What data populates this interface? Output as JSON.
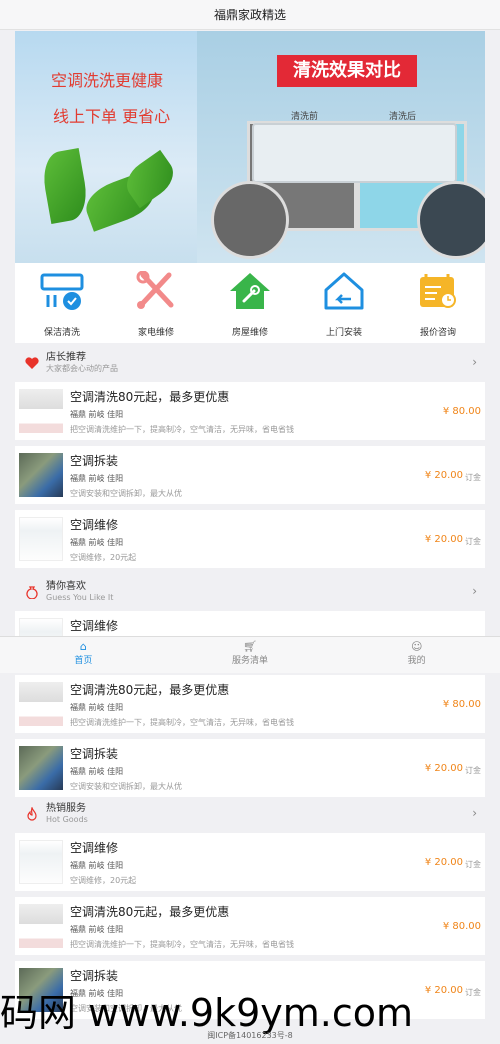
{
  "header": {
    "title": "福鼎家政精选"
  },
  "banner": {
    "line1": "空调洗洗更健康",
    "line2": "线上下单 更省心",
    "tag": "清洗效果对比",
    "before": "清洗前",
    "after": "清洗后"
  },
  "categories": [
    {
      "label": "保洁清洗",
      "icon": "ac-cleaning-icon"
    },
    {
      "label": "家电维修",
      "icon": "tools-icon"
    },
    {
      "label": "房屋维修",
      "icon": "house-wrench-icon"
    },
    {
      "label": "上门安装",
      "icon": "home-return-icon"
    },
    {
      "label": "报价咨询",
      "icon": "calendar-clock-icon"
    }
  ],
  "sections": {
    "recommend": {
      "title": "店长推荐",
      "subtitle": "大家都会心动的产品"
    },
    "guess": {
      "title": "猜你喜欢",
      "subtitle": "Guess You Like It"
    },
    "hot": {
      "title": "热销服务",
      "subtitle": "Hot Goods"
    }
  },
  "products": {
    "wash": {
      "title": "空调清洗80元起，最多更优惠",
      "meta": "福鼎 前岐 佳阳",
      "desc": "把空调清洗维护一下，提高制冷，空气清洁，无异味，省电省钱",
      "price": "¥ 80.00",
      "unit": ""
    },
    "install": {
      "title": "空调拆装",
      "meta": "福鼎 前岐 佳阳",
      "desc": "空调安装和空调拆卸，最大从优",
      "price": "¥ 20.00",
      "unit": "订金"
    },
    "repair": {
      "title": "空调维修",
      "meta": "福鼎 前岐 佳阳",
      "desc": "空调维修，20元起",
      "price": "¥ 20.00",
      "unit": "订金"
    }
  },
  "tabbar": {
    "home": "首页",
    "service": "服务清单",
    "mine": "我的"
  },
  "footer": {
    "icp": "闽ICP备14016233号-8"
  },
  "watermark": "码网 www.9k9ym.com",
  "colors": {
    "accent": "#1e8fe0",
    "price": "#f08519",
    "heart": "#e8332a",
    "banner_red": "#e23c31"
  }
}
